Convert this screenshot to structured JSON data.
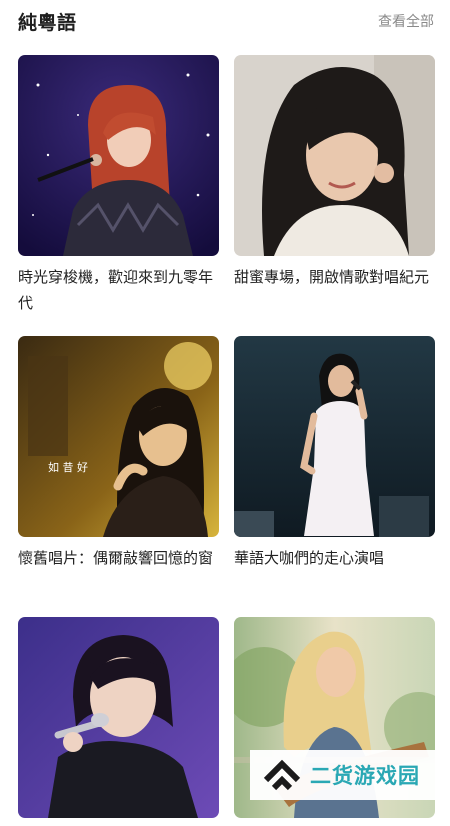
{
  "section": {
    "title": "純粵語",
    "view_all": "查看全部"
  },
  "playlists": [
    {
      "title": "時光穿梭機，歡迎來到九零年代"
    },
    {
      "title": "甜蜜專場，開啟情歌對唱紀元"
    },
    {
      "title": "懷舊唱片：偶爾敲響回憶的窗",
      "cover_text": "如 昔 好"
    },
    {
      "title": "華語大咖們的走心演唱"
    },
    {
      "title": ""
    },
    {
      "title": ""
    }
  ],
  "watermark": {
    "text": "二货游戏园"
  },
  "colors": {
    "watermark": "#2aa8b4",
    "link": "#8a8a8a"
  }
}
